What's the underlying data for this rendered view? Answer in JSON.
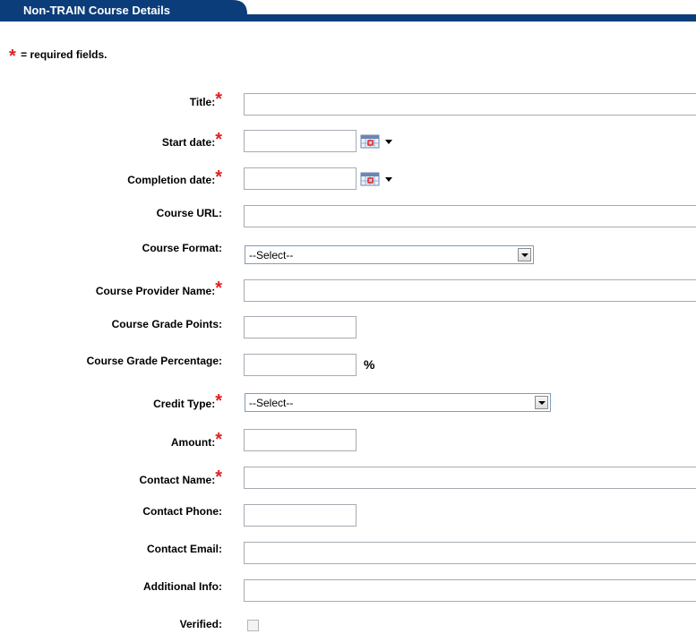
{
  "header": {
    "title": "Non-TRAIN Course Details"
  },
  "required_note": {
    "star": "*",
    "text": "= required fields."
  },
  "fields": {
    "title": {
      "label": "Title:",
      "value": ""
    },
    "start_date": {
      "label": "Start date:",
      "value": ""
    },
    "completion_date": {
      "label": "Completion date:",
      "value": ""
    },
    "course_url": {
      "label": "Course URL:",
      "value": ""
    },
    "course_format": {
      "label": "Course Format:",
      "selected": "--Select--"
    },
    "course_provider_name": {
      "label": "Course Provider Name:",
      "value": ""
    },
    "course_grade_points": {
      "label": "Course Grade Points:",
      "value": ""
    },
    "course_grade_percentage": {
      "label": "Course Grade Percentage:",
      "value": "",
      "suffix": "%"
    },
    "credit_type": {
      "label": "Credit Type:",
      "selected": "--Select--"
    },
    "amount": {
      "label": "Amount:",
      "value": ""
    },
    "contact_name": {
      "label": "Contact Name:",
      "value": ""
    },
    "contact_phone": {
      "label": "Contact Phone:",
      "value": ""
    },
    "contact_email": {
      "label": "Contact Email:",
      "value": ""
    },
    "additional_info": {
      "label": "Additional Info:",
      "value": ""
    },
    "verified": {
      "label": "Verified:",
      "checked": false
    }
  },
  "colors": {
    "header_bg": "#0b3d7a",
    "required_star": "#e02020"
  },
  "icons": {
    "calendar": "calendar-icon",
    "dropdown": "chevron-down-icon"
  }
}
